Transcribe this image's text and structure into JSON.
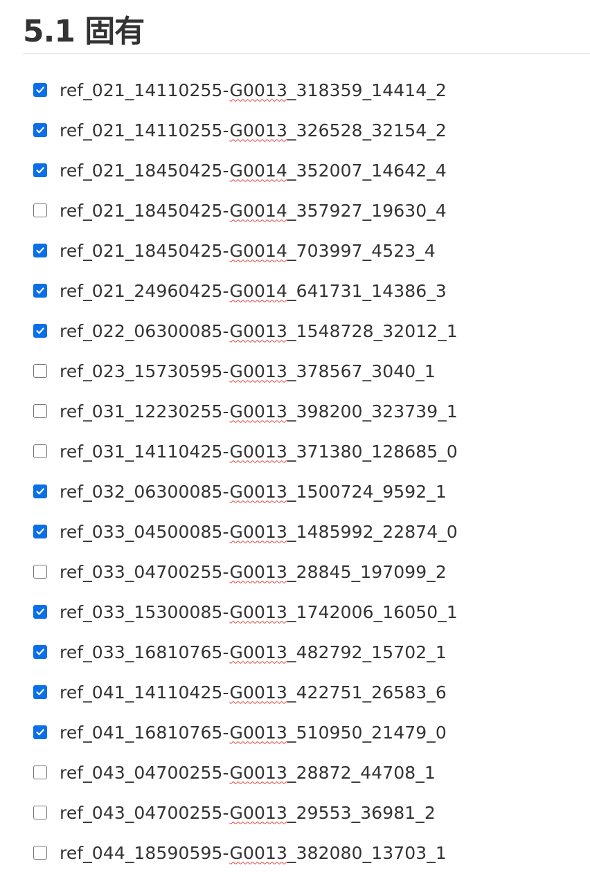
{
  "heading": "5.1 固有",
  "items": [
    {
      "pre": "ref_021_14110255-",
      "spell": "G0013",
      "post": "_318359_14414_2",
      "checked": true
    },
    {
      "pre": "ref_021_14110255-",
      "spell": "G0013",
      "post": "_326528_32154_2",
      "checked": true
    },
    {
      "pre": "ref_021_18450425-",
      "spell": "G0014",
      "post": "_352007_14642_4",
      "checked": true
    },
    {
      "pre": "ref_021_18450425-",
      "spell": "G0014",
      "post": "_357927_19630_4",
      "checked": false
    },
    {
      "pre": "ref_021_18450425-",
      "spell": "G0014",
      "post": "_703997_4523_4",
      "checked": true
    },
    {
      "pre": "ref_021_24960425-",
      "spell": "G0014",
      "post": "_641731_14386_3",
      "checked": true
    },
    {
      "pre": "ref_022_06300085-",
      "spell": "G0013",
      "post": "_1548728_32012_1",
      "checked": true
    },
    {
      "pre": "ref_023_15730595-",
      "spell": "G0013",
      "post": "_378567_3040_1",
      "checked": false
    },
    {
      "pre": "ref_031_12230255-",
      "spell": "G0013",
      "post": "_398200_323739_1",
      "checked": false
    },
    {
      "pre": "ref_031_14110425-",
      "spell": "G0013",
      "post": "_371380_128685_0",
      "checked": false
    },
    {
      "pre": "ref_032_06300085-",
      "spell": "G0013",
      "post": "_1500724_9592_1",
      "checked": true
    },
    {
      "pre": "ref_033_04500085-",
      "spell": "G0013",
      "post": "_1485992_22874_0",
      "checked": true
    },
    {
      "pre": "ref_033_04700255-",
      "spell": "G0013",
      "post": "_28845_197099_2",
      "checked": false
    },
    {
      "pre": "ref_033_15300085-",
      "spell": "G0013",
      "post": "_1742006_16050_1",
      "checked": true
    },
    {
      "pre": "ref_033_16810765-",
      "spell": "G0013",
      "post": "_482792_15702_1",
      "checked": true
    },
    {
      "pre": "ref_041_14110425-",
      "spell": "G0013",
      "post": "_422751_26583_6",
      "checked": true
    },
    {
      "pre": "ref_041_16810765-",
      "spell": "G0013",
      "post": "_510950_21479_0",
      "checked": true
    },
    {
      "pre": "ref_043_04700255-",
      "spell": "G0013",
      "post": "_28872_44708_1",
      "checked": false
    },
    {
      "pre": "ref_043_04700255-",
      "spell": "G0013",
      "post": "_29553_36981_2",
      "checked": false
    },
    {
      "pre": "ref_044_18590595-",
      "spell": "G0013",
      "post": "_382080_13703_1",
      "checked": false
    }
  ]
}
